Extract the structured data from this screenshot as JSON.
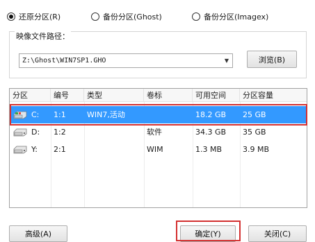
{
  "restore_mode": {
    "options": [
      {
        "label": "还原分区(R)",
        "selected": true
      },
      {
        "label": "备份分区(Ghost)",
        "selected": false
      },
      {
        "label": "备份分区(Imagex)",
        "selected": false
      }
    ]
  },
  "image_path": {
    "legend": "映像文件路径：",
    "value": "Z:\\Ghost\\WIN7SP1.GHO",
    "browse_label": "浏览(B)"
  },
  "partition_table": {
    "columns": [
      "分区",
      "编号",
      "类型",
      "卷标",
      "可用空间",
      "分区容量"
    ],
    "rows": [
      {
        "drive": "C:",
        "number": "1:1",
        "type": "WIN7,活动",
        "label": "",
        "free": "18.2 GB",
        "capacity": "25 GB",
        "selected": true,
        "icon": "system-drive-icon"
      },
      {
        "drive": "D:",
        "number": "1:2",
        "type": "",
        "label": "软件",
        "free": "34.3 GB",
        "capacity": "35 GB",
        "selected": false,
        "icon": "hard-drive-icon"
      },
      {
        "drive": "Y:",
        "number": "2:1",
        "type": "",
        "label": "WIM",
        "free": "1.3 MB",
        "capacity": "3.9 MB",
        "selected": false,
        "icon": "hard-drive-icon"
      }
    ]
  },
  "footer": {
    "advanced_label": "高级(A)",
    "ok_label": "确定(Y)",
    "close_label": "关闭(C)"
  },
  "colors": {
    "selection": "#3399ff",
    "highlight_box": "#d32f2f"
  }
}
